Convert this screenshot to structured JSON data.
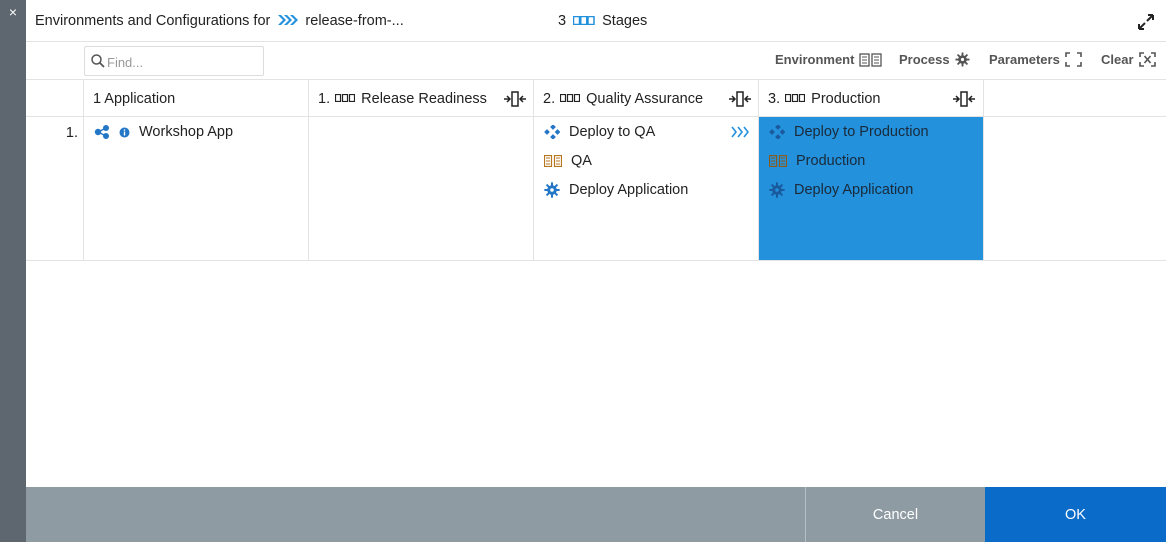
{
  "window": {
    "close_glyph": "×",
    "title_prefix": "Environments and Configurations for",
    "release_name": "release-from-...",
    "stages_count": "3",
    "stages_label": "Stages",
    "expand_icon": "expand-icon"
  },
  "toolbar": {
    "search_placeholder": "Find...",
    "environment_label": "Environment",
    "process_label": "Process",
    "parameters_label": "Parameters",
    "clear_label": "Clear"
  },
  "columns": {
    "application": "1 Application",
    "stage1_num": "1.",
    "stage1": "Release Readiness",
    "stage2_num": "2.",
    "stage2": "Quality Assurance",
    "stage3_num": "3.",
    "stage3": "Production"
  },
  "row": {
    "number": "1.",
    "application": "Workshop App",
    "qa": {
      "process": "Deploy to QA",
      "environment": "QA",
      "application_process": "Deploy Application"
    },
    "production": {
      "process": "Deploy to Production",
      "environment": "Production",
      "application_process": "Deploy Application"
    }
  },
  "footer": {
    "cancel_label": "Cancel",
    "ok_label": "OK"
  },
  "colors": {
    "accent": "#2391dc",
    "ok_button": "#0a6bc8",
    "footer": "#8f9ba3",
    "side_strip": "#5e6770"
  }
}
